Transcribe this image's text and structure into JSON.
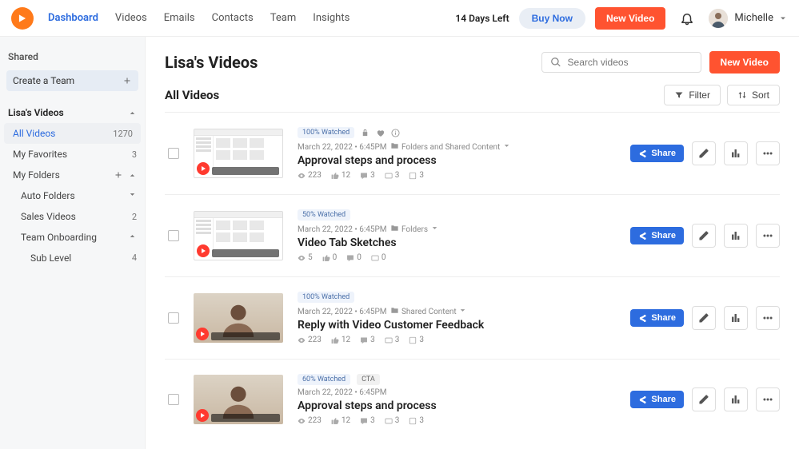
{
  "header": {
    "nav": [
      "Dashboard",
      "Videos",
      "Emails",
      "Contacts",
      "Team",
      "Insights"
    ],
    "active_nav_index": 0,
    "trial_text": "14 Days Left",
    "buy_label": "Buy Now",
    "new_video_label": "New Video",
    "user_name": "Michelle"
  },
  "sidebar": {
    "shared_label": "Shared",
    "create_team_label": "Create a Team",
    "section_title": "Lisa's Videos",
    "items": [
      {
        "label": "All Videos",
        "count": "1270",
        "active": true
      },
      {
        "label": "My Favorites",
        "count": "3"
      },
      {
        "label": "My Folders",
        "add_plus": true,
        "expander": true
      }
    ],
    "folders": [
      {
        "label": "Auto Folders",
        "count": "",
        "expander": true,
        "chev": "down"
      },
      {
        "label": "Sales Videos",
        "count": "2"
      },
      {
        "label": "Team Onboarding",
        "count": "",
        "expander": true,
        "chev": "up",
        "children": [
          {
            "label": "Sub Level",
            "count": "4"
          }
        ]
      }
    ]
  },
  "page": {
    "title": "Lisa's Videos",
    "subtitle": "All Videos",
    "search_placeholder": "Search videos",
    "new_video_label": "New Video",
    "filter_label": "Filter",
    "sort_label": "Sort"
  },
  "share_label": "Share",
  "videos": [
    {
      "thumb_kind": "browser",
      "watched_badge": "100% Watched",
      "extra_icons": [
        "lock",
        "heart",
        "info"
      ],
      "date": "March 22, 2022 • 6:45PM",
      "folder": "Folders and Shared Content",
      "folder_chev": true,
      "title": "Approval steps and process",
      "stats": {
        "views": "223",
        "likes": "12",
        "comments": "3",
        "cc": "3",
        "q": "3"
      }
    },
    {
      "thumb_kind": "browser",
      "watched_badge": "50% Watched",
      "date": "March 22, 2022 • 6:45PM",
      "folder": "Folders",
      "folder_chev": true,
      "title": "Video Tab Sketches",
      "stats": {
        "views": "5",
        "likes": "0",
        "comments": "0",
        "cc": "0"
      }
    },
    {
      "thumb_kind": "person",
      "watched_badge": "100% Watched",
      "date": "March 22, 2022 • 6:45PM",
      "folder": "Shared Content",
      "folder_chev": true,
      "title": "Reply with Video Customer Feedback",
      "stats": {
        "views": "223",
        "likes": "12",
        "comments": "3",
        "cc": "3",
        "q": "3"
      }
    },
    {
      "thumb_kind": "person",
      "watched_badge": "60% Watched",
      "extra_badges": [
        "CTA"
      ],
      "date": "March 22, 2022 • 6:45PM",
      "title": "Approval steps and process",
      "stats": {
        "views": "223",
        "likes": "12",
        "comments": "3",
        "cc": "3",
        "q": "3"
      }
    }
  ]
}
